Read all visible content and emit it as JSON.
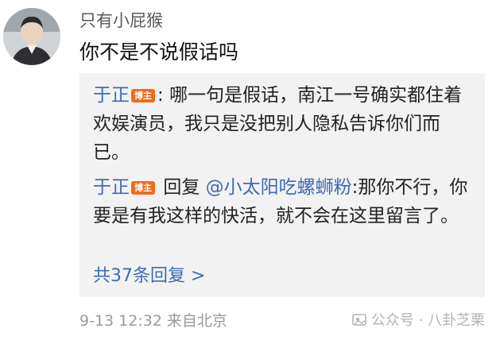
{
  "comment": {
    "username": "只有小屁猴",
    "text": "你不是不说假话吗",
    "meta": {
      "time": "9-13 12:32",
      "location": "来自北京"
    }
  },
  "replies": [
    {
      "author": "于正",
      "badge": "博主",
      "separator": ":",
      "text": "哪一句是假话，南江一号确实都住着欢娱演员，我只是没把别人隐私告诉你们而已。"
    },
    {
      "author": "于正",
      "badge": "博主",
      "reply_word": "回复",
      "mention": "@小太阳吃螺蛳粉",
      "text": ":那你不行，你要是有我这样的快活，就不会在这里留言了。"
    }
  ],
  "more_replies": "共37条回复 >",
  "watermark": "公众号 · 八卦芝栗",
  "colors": {
    "link": "#3f6ab5",
    "badge": "#f26a1b",
    "reply_bg": "#f2f2f2",
    "meta": "#9a9a9a"
  }
}
